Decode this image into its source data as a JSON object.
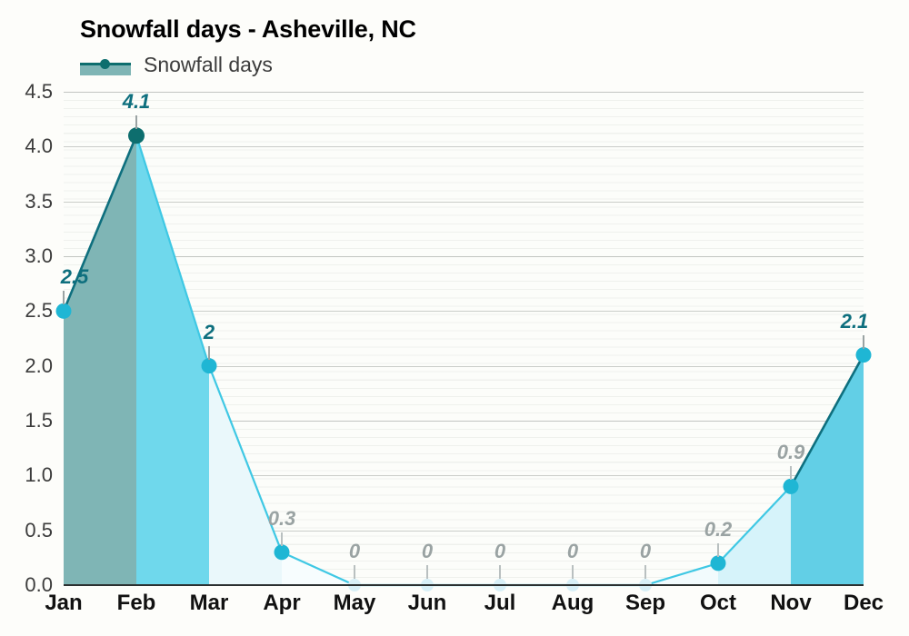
{
  "chart_data": {
    "type": "area",
    "title": "Snowfall days - Asheville, NC",
    "xlabel": "",
    "ylabel": "",
    "ylim": [
      0.0,
      4.5
    ],
    "grid": true,
    "legend_position": "top-left",
    "categories": [
      "Jan",
      "Feb",
      "Mar",
      "Apr",
      "May",
      "Jun",
      "Jul",
      "Aug",
      "Sep",
      "Oct",
      "Nov",
      "Dec"
    ],
    "series": [
      {
        "name": "Snowfall days",
        "values": [
          2.5,
          4.1,
          2,
          0.3,
          0,
          0,
          0,
          0,
          0,
          0.2,
          0.9,
          2.1
        ]
      }
    ],
    "point_labels": [
      "2.5",
      "4.1",
      "2",
      "0.3",
      "0",
      "0",
      "0",
      "0",
      "0",
      "0.2",
      "0.9",
      "2.1"
    ],
    "ytick_labels": [
      "4.5",
      "4.0",
      "3.5",
      "3.0",
      "2.5",
      "2.0",
      "1.5",
      "1.0",
      "0.5",
      "0.0"
    ],
    "ytick_values": [
      4.5,
      4.0,
      3.5,
      3.0,
      2.5,
      2.0,
      1.5,
      1.0,
      0.5,
      0.0
    ],
    "colors": {
      "line_dark": "#0e6f7e",
      "line_light": "#3fc8e4",
      "marker_dark": "#0d6e6e",
      "marker_light": "#1fb6d4",
      "label_dark": "#0e6f7e",
      "label_gray": "#9aa3a3",
      "axis": "#2b3030",
      "background": "#fdfdfa",
      "plot_background": "#fcfdfa",
      "gridline": "#c8cdc8"
    },
    "band_fills": [
      "#7fb5b5",
      "#6fd8ec",
      "#eaf8fb",
      "#f7fdfe",
      "#fbfeff",
      "#fbfeff",
      "#fbfeff",
      "#fbfeff",
      "#f2fbfd",
      "#d6f3fa",
      "#62cfe6"
    ]
  },
  "title": "Snowfall days - Asheville, NC",
  "legend": {
    "label": "Snowfall days"
  }
}
